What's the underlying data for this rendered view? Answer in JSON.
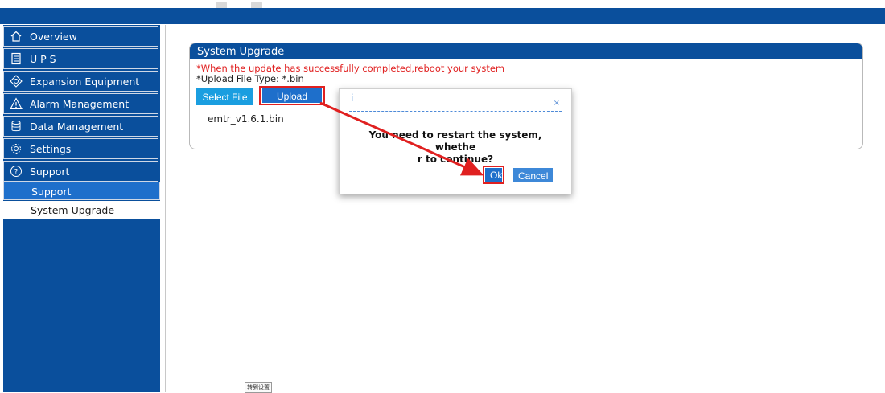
{
  "sidebar": {
    "items": [
      {
        "label": "Overview",
        "icon": "home-icon"
      },
      {
        "label": "U P S",
        "icon": "ups-icon"
      },
      {
        "label": "Expansion Equipment",
        "icon": "expansion-icon"
      },
      {
        "label": "Alarm Management",
        "icon": "alarm-icon"
      },
      {
        "label": "Data Management",
        "icon": "database-icon"
      },
      {
        "label": "Settings",
        "icon": "gear-icon"
      },
      {
        "label": "Support",
        "icon": "help-icon"
      }
    ],
    "sub_active": "Support",
    "sub_item": "System Upgrade"
  },
  "panel": {
    "title": "System Upgrade",
    "warning": "*When the update has successfully completed,reboot your system",
    "file_type": "*Upload File Type: *.bin",
    "select_label": "Select File",
    "upload_label": "Upload",
    "file_name": "emtr_v1.6.1.bin"
  },
  "dialog": {
    "title": "i",
    "close": "×",
    "message_line1": "You need to restart the system, whethe",
    "message_line2": "r to continue?",
    "ok_label": "Ok",
    "cancel_label": "Cancel"
  },
  "footer_box": "转到设置",
  "colors": {
    "primary": "#0a4f9c",
    "accent": "#1e6fcb",
    "select_button": "#1a9ee0",
    "warning_text": "#e02020",
    "annotation": "#e02020"
  }
}
